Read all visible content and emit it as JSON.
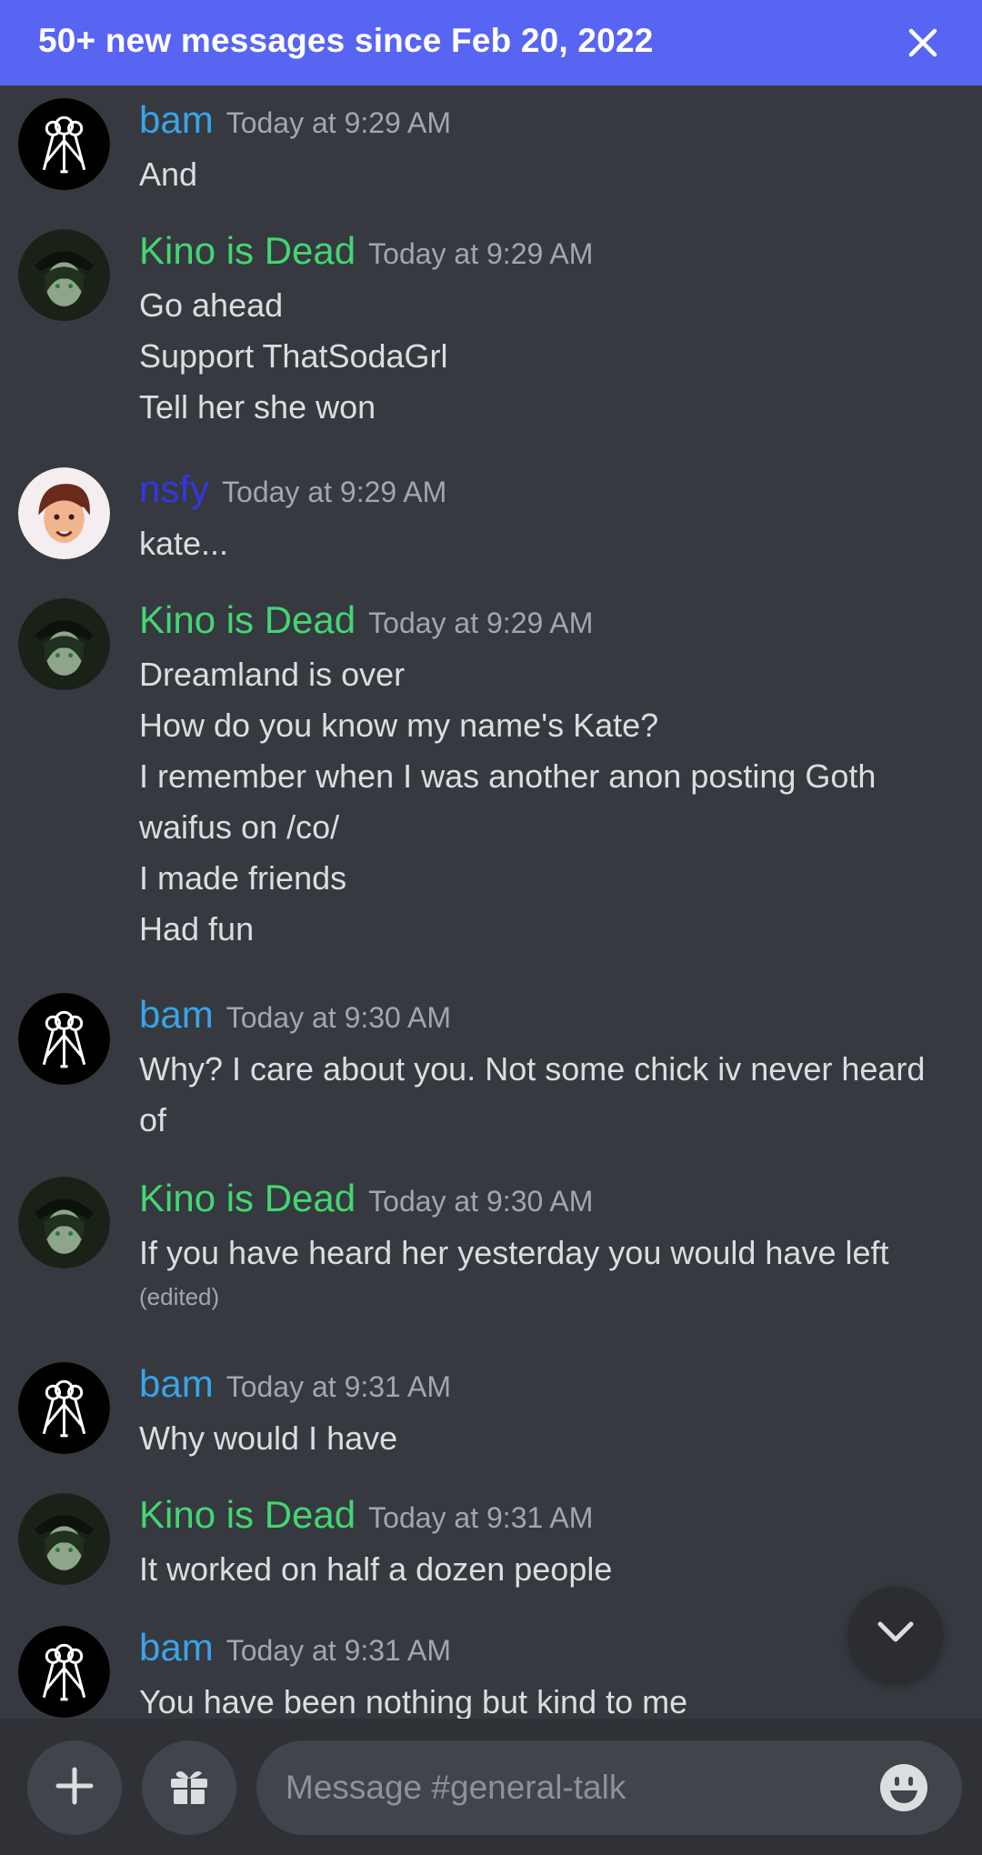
{
  "banner": {
    "text": "50+ new messages since Feb 20, 2022",
    "close_icon": "close-icon"
  },
  "colors": {
    "banner": "#5865f2",
    "bam": "#3ba3e6",
    "kino": "#43d672",
    "nsfy": "#3436e0",
    "background": "#36393f"
  },
  "messages": [
    {
      "author": "bam",
      "timestamp": "Today at 9:29 AM",
      "avatar": "bam-avatar",
      "lines": [
        "And"
      ]
    },
    {
      "author": "Kino is Dead",
      "timestamp": "Today at 9:29 AM",
      "avatar": "kino-avatar",
      "lines": [
        "Go ahead",
        "Support ThatSodaGrl",
        "Tell her she won"
      ]
    },
    {
      "author": "nsfy",
      "timestamp": "Today at 9:29 AM",
      "avatar": "nsfy-avatar",
      "lines": [
        "kate..."
      ]
    },
    {
      "author": "Kino is Dead",
      "timestamp": "Today at 9:29 AM",
      "avatar": "kino-avatar",
      "lines": [
        "Dreamland is over",
        "How do you know my name's Kate?",
        "I remember when I was another anon posting Goth",
        "waifus on /co/",
        "I made friends",
        "Had fun"
      ]
    },
    {
      "author": "bam",
      "timestamp": "Today at 9:30 AM",
      "avatar": "bam-avatar",
      "lines": [
        "Why? I care about you. Not some chick iv never heard",
        "of"
      ]
    },
    {
      "author": "Kino is Dead",
      "timestamp": "Today at 9:30 AM",
      "avatar": "kino-avatar",
      "lines": [
        "If you have heard her yesterday you would have left"
      ],
      "edited": "(edited)"
    },
    {
      "author": "bam",
      "timestamp": "Today at 9:31 AM",
      "avatar": "bam-avatar",
      "lines": [
        "Why would I have"
      ]
    },
    {
      "author": "Kino is Dead",
      "timestamp": "Today at 9:31 AM",
      "avatar": "kino-avatar",
      "lines": [
        "It worked on half a dozen people"
      ]
    },
    {
      "author": "bam",
      "timestamp": "Today at 9:31 AM",
      "avatar": "bam-avatar",
      "lines": [
        "You have been nothing but kind to me"
      ]
    }
  ],
  "composer": {
    "placeholder": "Message #general-talk",
    "add_icon": "plus-icon",
    "gift_icon": "gift-icon",
    "emoji_icon": "emoji-icon"
  },
  "jump_button": {
    "icon": "chevron-down-icon"
  }
}
